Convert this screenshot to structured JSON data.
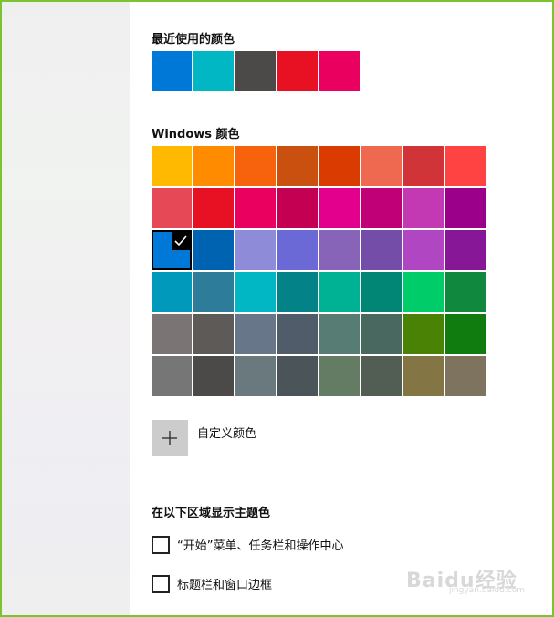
{
  "recent": {
    "heading": "最近使用的颜色",
    "swatches": [
      "#0078d7",
      "#00b7c3",
      "#4c4a48",
      "#e81123",
      "#ea005e"
    ]
  },
  "windows_colors": {
    "heading": "Windows 颜色",
    "selected_index": 16,
    "swatches": [
      "#ffb900",
      "#ff8c00",
      "#f7630c",
      "#ca5010",
      "#da3b01",
      "#ef6950",
      "#d13438",
      "#ff4343",
      "#e74856",
      "#e81123",
      "#ea005e",
      "#c30052",
      "#e3008c",
      "#bf0077",
      "#c239b3",
      "#9a0089",
      "#0078d7",
      "#0063b1",
      "#8e8cd8",
      "#6b69d6",
      "#8764b8",
      "#744da9",
      "#b146c2",
      "#881798",
      "#0099bc",
      "#2d7d9a",
      "#00b7c3",
      "#038387",
      "#00b294",
      "#018574",
      "#00cc6a",
      "#10893e",
      "#7a7574",
      "#5d5a58",
      "#68768a",
      "#515c6b",
      "#567c73",
      "#486860",
      "#498205",
      "#107c10",
      "#767676",
      "#4c4a48",
      "#69797e",
      "#4a5459",
      "#647c64",
      "#525e54",
      "#847545",
      "#7e735f"
    ]
  },
  "custom": {
    "label": "自定义颜色"
  },
  "accent_surfaces": {
    "heading": "在以下区域显示主题色",
    "options": [
      {
        "label": "“开始”菜单、任务栏和操作中心",
        "checked": false
      },
      {
        "label": "标题栏和窗口边框",
        "checked": false
      }
    ]
  },
  "watermark": {
    "text": "Baidu经验",
    "url": "jingyan.baidu.com"
  }
}
